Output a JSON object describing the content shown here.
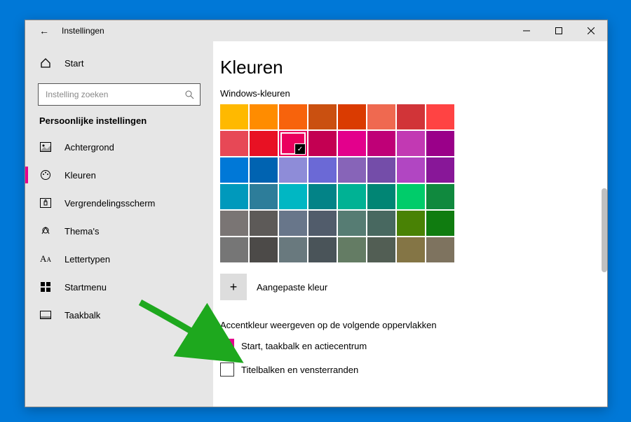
{
  "window": {
    "title": "Instellingen"
  },
  "sidebar": {
    "home": "Start",
    "searchPlaceholder": "Instelling zoeken",
    "category": "Persoonlijke instellingen",
    "items": [
      {
        "icon": "image-icon",
        "label": "Achtergrond",
        "id": "achtergrond",
        "selected": false
      },
      {
        "icon": "palette-icon",
        "label": "Kleuren",
        "id": "kleuren",
        "selected": true
      },
      {
        "icon": "lock-icon",
        "label": "Vergrendelingsscherm",
        "id": "vergrendelingsscherm",
        "selected": false
      },
      {
        "icon": "themes-icon",
        "label": "Thema's",
        "id": "themas",
        "selected": false
      },
      {
        "icon": "font-icon",
        "label": "Lettertypen",
        "id": "lettertypen",
        "selected": false
      },
      {
        "icon": "start-icon",
        "label": "Startmenu",
        "id": "startmenu",
        "selected": false
      },
      {
        "icon": "taskbar-icon",
        "label": "Taakbalk",
        "id": "taakbalk",
        "selected": false
      }
    ]
  },
  "content": {
    "heading": "Kleuren",
    "paletteLabel": "Windows-kleuren",
    "customColorLabel": "Aangepaste kleur",
    "surfacesHeading": "Accentkleur weergeven op de volgende oppervlakken",
    "checkboxes": [
      {
        "label": "Start, taakbalk en actiecentrum",
        "checked": true
      },
      {
        "label": "Titelbalken en vensterranden",
        "checked": false
      }
    ],
    "selectedSwatchIndex": 10,
    "accentColor": "#e3008c",
    "swatches": [
      "#ffb900",
      "#ff8c00",
      "#f7630c",
      "#ca5010",
      "#da3b01",
      "#ef6950",
      "#d13438",
      "#ff4343",
      "#e74856",
      "#e81123",
      "#ea005e",
      "#c30052",
      "#e3008c",
      "#bf0077",
      "#c239b3",
      "#9a0089",
      "#0078d7",
      "#0063b1",
      "#8e8cd8",
      "#6b69d6",
      "#8764b8",
      "#744da9",
      "#b146c2",
      "#881798",
      "#0099bc",
      "#2d7d9a",
      "#00b7c3",
      "#038387",
      "#00b294",
      "#018574",
      "#00cc6a",
      "#10893e",
      "#7a7574",
      "#5d5a58",
      "#68768a",
      "#515c6b",
      "#567c73",
      "#486860",
      "#498205",
      "#107c10",
      "#767676",
      "#4c4a48",
      "#69797e",
      "#4a5459",
      "#647c64",
      "#525e54",
      "#847545",
      "#7e735f"
    ]
  }
}
